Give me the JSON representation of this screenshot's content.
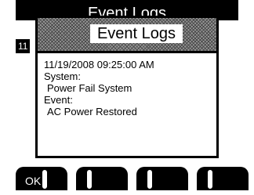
{
  "background": {
    "header_title": "Event Logs",
    "page_badge": "11"
  },
  "dialog": {
    "title": "Event Logs",
    "timestamp": "11/19/2008  09:25:00 AM",
    "system_label": "System:",
    "system_value": "Power Fail System",
    "event_label": "Event:",
    "event_value": "AC Power Restored"
  },
  "softkeys": {
    "key1_label": "OK",
    "key2_label": "",
    "key3_label": "",
    "key4_label": ""
  },
  "colors": {
    "foreground": "#000000",
    "background": "#ffffff"
  }
}
